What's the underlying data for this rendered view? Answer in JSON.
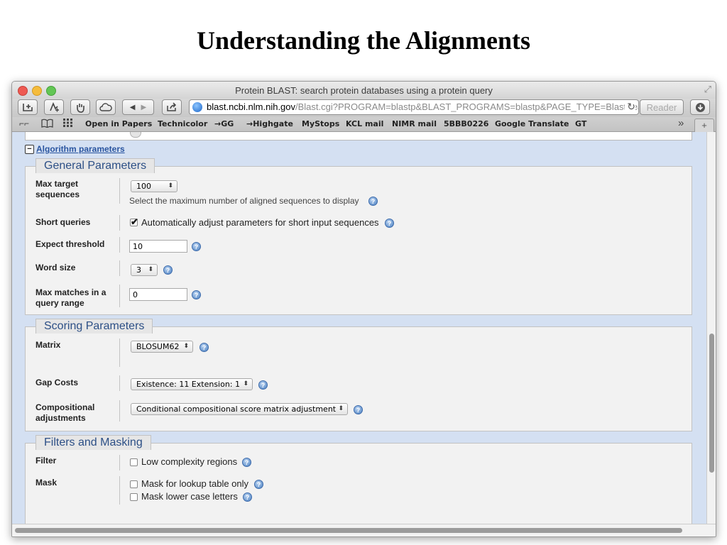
{
  "slide": {
    "title": "Understanding the Alignments"
  },
  "window": {
    "title": "Protein BLAST: search protein databases using a protein query",
    "url_domain": "blast.ncbi.nlm.nih.gov",
    "url_path": "/Blast.cgi?PROGRAM=blastp&BLAST_PROGRAMS=blastp&PAGE_TYPE=BlastSea",
    "reader_label": "Reader"
  },
  "bookmarks": [
    "Open in Papers",
    "Technicolor",
    "→GG",
    "→Highgate",
    "MyStops",
    "KCL mail",
    "NIMR mail",
    "5BBB0226",
    "Google Translate",
    "GT"
  ],
  "algorithm": {
    "toggle": "−",
    "link": "Algorithm parameters"
  },
  "general": {
    "heading": "General Parameters",
    "max_target_label": "Max target sequences",
    "max_target_value": "100",
    "max_target_note": "Select the maximum number of aligned sequences to display",
    "short_queries_label": "Short queries",
    "short_queries_option": "Automatically adjust parameters for short input sequences",
    "short_queries_checked": true,
    "expect_label": "Expect threshold",
    "expect_value": "10",
    "word_size_label": "Word size",
    "word_size_value": "3",
    "max_matches_label": "Max matches in a query range",
    "max_matches_value": "0"
  },
  "scoring": {
    "heading": "Scoring Parameters",
    "matrix_label": "Matrix",
    "matrix_value": "BLOSUM62",
    "gap_label": "Gap Costs",
    "gap_value": "Existence: 11 Extension: 1",
    "comp_label": "Compositional adjustments",
    "comp_value": "Conditional compositional score matrix adjustment"
  },
  "filters": {
    "heading": "Filters and Masking",
    "filter_label": "Filter",
    "low_complexity": "Low complexity regions",
    "low_complexity_checked": false,
    "mask_label": "Mask",
    "mask_lookup": "Mask for lookup table only",
    "mask_lookup_checked": false,
    "mask_lower": "Mask lower case letters",
    "mask_lower_checked": false
  },
  "icons": {
    "help": "help-icon",
    "checkmark": "✔",
    "reload": "↻",
    "download": "download-icon",
    "globe": "globe-icon"
  },
  "colors": {
    "page_bg": "#d4e0f2",
    "section_heading": "#2c4f86",
    "link": "#2a55a0"
  }
}
